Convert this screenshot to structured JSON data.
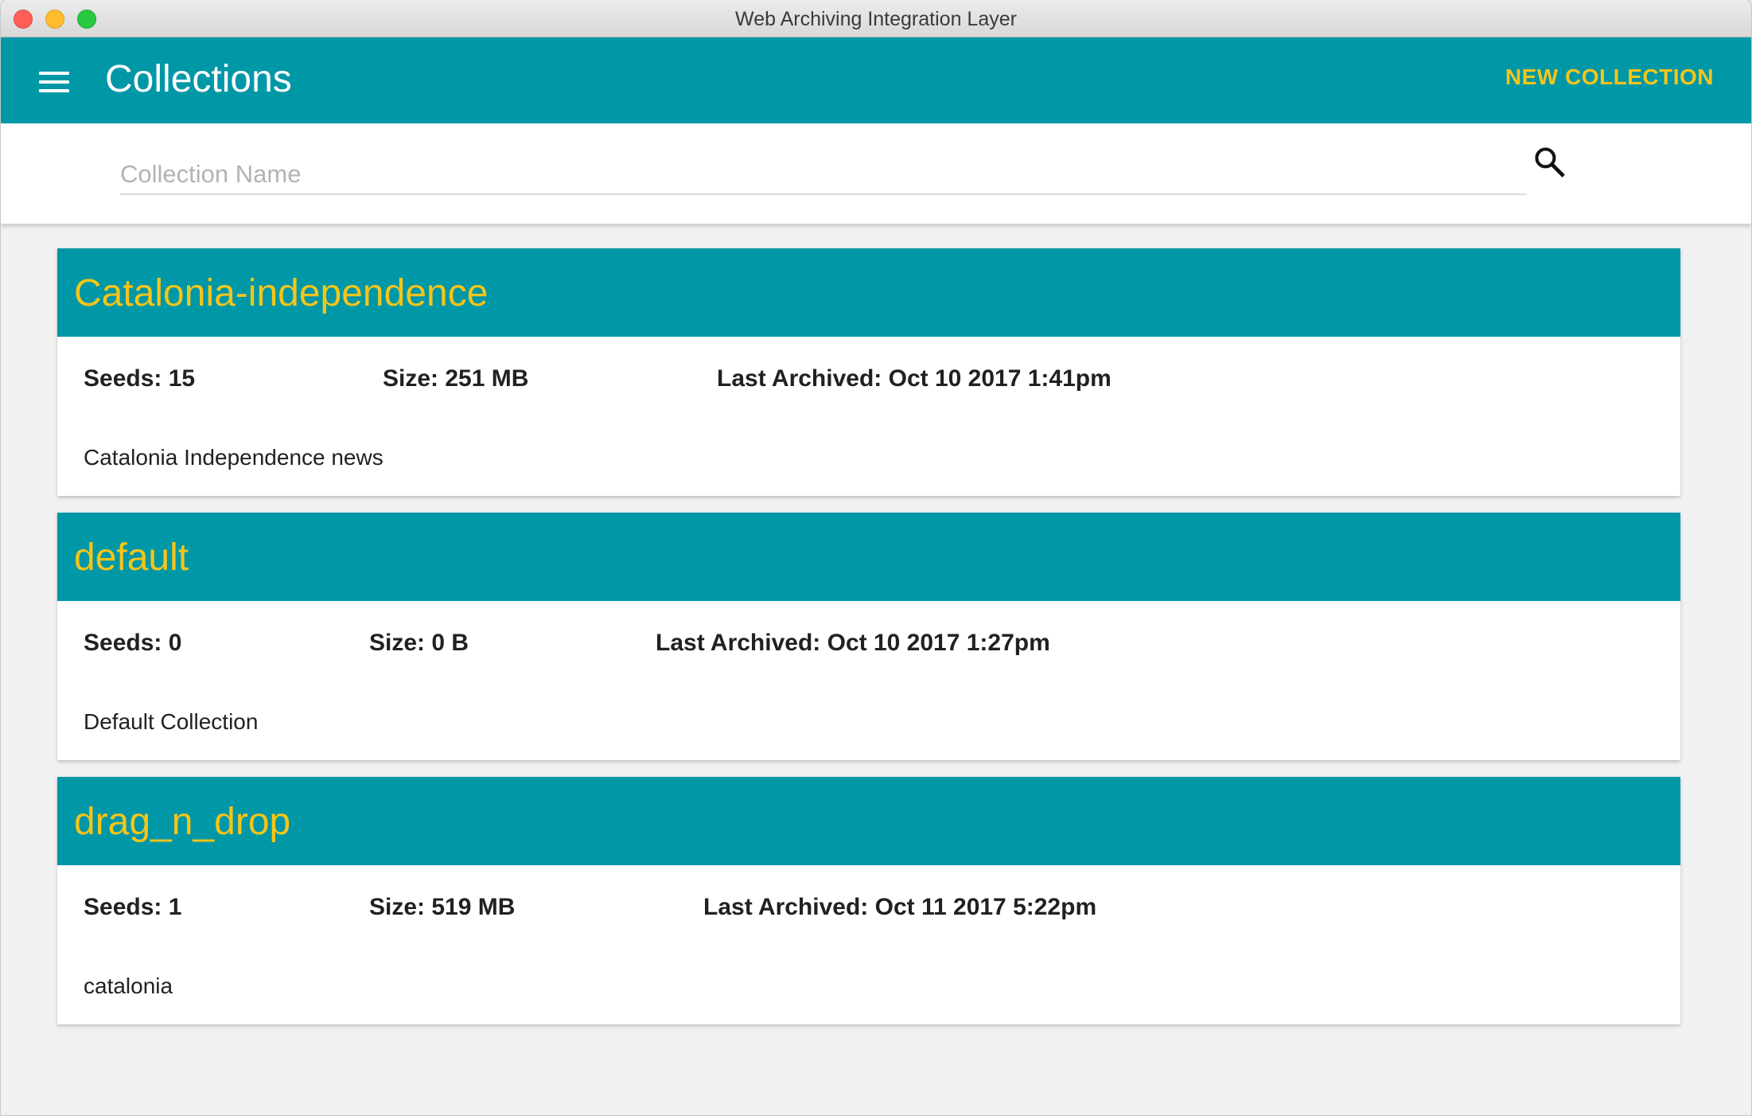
{
  "window": {
    "title": "Web Archiving Integration Layer"
  },
  "appbar": {
    "title": "Collections",
    "new_collection_label": "NEW COLLECTION"
  },
  "search": {
    "placeholder": "Collection Name",
    "value": ""
  },
  "colors": {
    "primary": "#0097a7",
    "accent": "#f5c518"
  },
  "collections": [
    {
      "name": "Catalonia-independence",
      "seeds": "Seeds: 15",
      "size": "Size: 251 MB",
      "last_archived": "Last Archived: Oct 10 2017 1:41pm",
      "description": "Catalonia Independence news"
    },
    {
      "name": "default",
      "seeds": "Seeds: 0",
      "size": "Size: 0 B",
      "last_archived": "Last Archived: Oct 10 2017 1:27pm",
      "description": "Default Collection"
    },
    {
      "name": "drag_n_drop",
      "seeds": "Seeds: 1",
      "size": "Size: 519 MB",
      "last_archived": "Last Archived: Oct 11 2017 5:22pm",
      "description": "catalonia"
    }
  ]
}
